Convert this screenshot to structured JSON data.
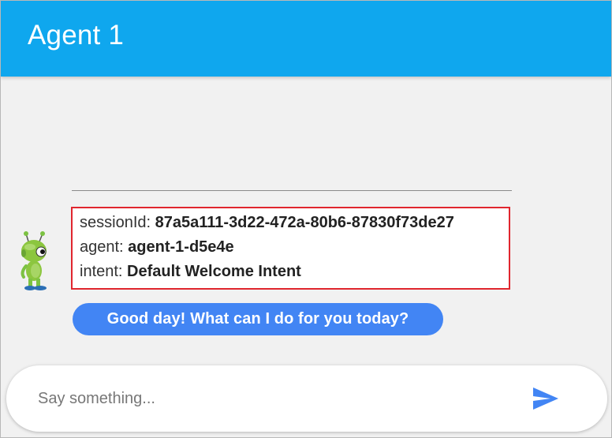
{
  "header": {
    "title": "Agent 1"
  },
  "info": {
    "session_key": "sessionId:",
    "session_value": "87a5a111-3d22-472a-80b6-87830f73de27",
    "agent_key": "agent:",
    "agent_value": "agent-1-d5e4e",
    "intent_key": "intent:",
    "intent_value": "Default Welcome Intent"
  },
  "message": {
    "text": "Good day! What can I do for you today?"
  },
  "composer": {
    "placeholder": "Say something...",
    "value": ""
  },
  "icons": {
    "send": "send-icon",
    "avatar": "bot-avatar"
  },
  "colors": {
    "header": "#0fa7ee",
    "bubble": "#4285f4",
    "highlight_border": "#e0262e",
    "send_icon": "#4285f4"
  }
}
